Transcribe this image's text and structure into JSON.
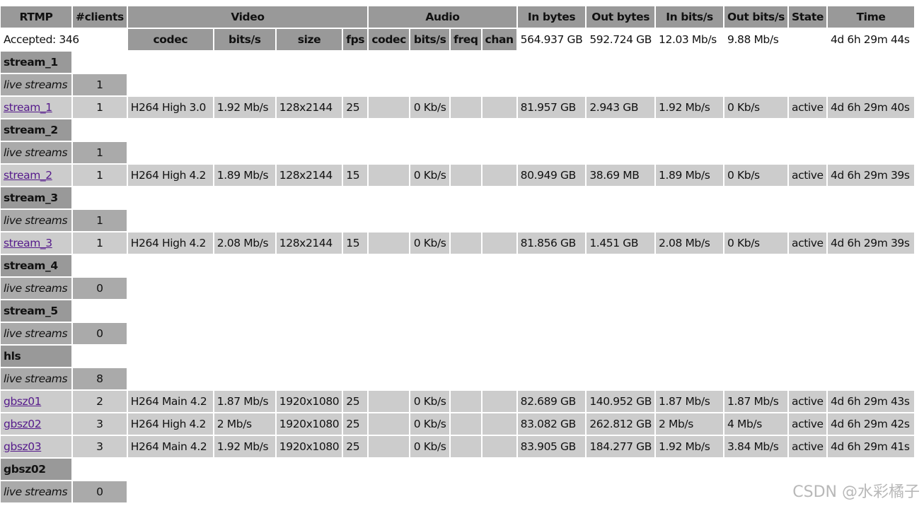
{
  "header": {
    "rtmp": "RTMP",
    "clients": "#clients",
    "video": "Video",
    "audio": "Audio",
    "in_bytes": "In bytes",
    "out_bytes": "Out bytes",
    "in_bits": "In bits/s",
    "out_bits": "Out bits/s",
    "state": "State",
    "time": "Time",
    "video_sub": [
      "codec",
      "bits/s",
      "size",
      "fps"
    ],
    "audio_sub": [
      "codec",
      "bits/s",
      "freq",
      "chan"
    ]
  },
  "summary": {
    "accepted": "Accepted: 346",
    "in_bytes": "564.937 GB",
    "out_bytes": "592.724 GB",
    "in_bits": "12.03 Mb/s",
    "out_bits": "9.88 Mb/s",
    "time": "4d 6h 29m 44s"
  },
  "live_label": "live streams",
  "applications": [
    {
      "name": "stream_1",
      "live_count": "1",
      "streams": [
        {
          "name": "stream_1",
          "clients": "1",
          "vcodec": "H264 High 3.0",
          "vbits": "1.92 Mb/s",
          "size": "128x2144",
          "fps": "25",
          "acodec": "",
          "abits": "0 Kb/s",
          "freq": "",
          "chan": "",
          "in_bytes": "81.957 GB",
          "out_bytes": "2.943 GB",
          "in_bits": "1.92 Mb/s",
          "out_bits": "0 Kb/s",
          "state": "active",
          "time": "4d 6h 29m 40s"
        }
      ]
    },
    {
      "name": "stream_2",
      "live_count": "1",
      "streams": [
        {
          "name": "stream_2",
          "clients": "1",
          "vcodec": "H264 High 4.2",
          "vbits": "1.89 Mb/s",
          "size": "128x2144",
          "fps": "15",
          "acodec": "",
          "abits": "0 Kb/s",
          "freq": "",
          "chan": "",
          "in_bytes": "80.949 GB",
          "out_bytes": "38.69 MB",
          "in_bits": "1.89 Mb/s",
          "out_bits": "0 Kb/s",
          "state": "active",
          "time": "4d 6h 29m 39s"
        }
      ]
    },
    {
      "name": "stream_3",
      "live_count": "1",
      "streams": [
        {
          "name": "stream_3",
          "clients": "1",
          "vcodec": "H264 High 4.2",
          "vbits": "2.08 Mb/s",
          "size": "128x2144",
          "fps": "15",
          "acodec": "",
          "abits": "0 Kb/s",
          "freq": "",
          "chan": "",
          "in_bytes": "81.856 GB",
          "out_bytes": "1.451 GB",
          "in_bits": "2.08 Mb/s",
          "out_bits": "0 Kb/s",
          "state": "active",
          "time": "4d 6h 29m 39s"
        }
      ]
    },
    {
      "name": "stream_4",
      "live_count": "0",
      "streams": []
    },
    {
      "name": "stream_5",
      "live_count": "0",
      "streams": []
    },
    {
      "name": "hls",
      "live_count": "8",
      "streams": [
        {
          "name": "gbsz01",
          "clients": "2",
          "vcodec": "H264 Main 4.2",
          "vbits": "1.87 Mb/s",
          "size": "1920x1080",
          "fps": "25",
          "acodec": "",
          "abits": "0 Kb/s",
          "freq": "",
          "chan": "",
          "in_bytes": "82.689 GB",
          "out_bytes": "140.952 GB",
          "in_bits": "1.87 Mb/s",
          "out_bits": "1.87 Mb/s",
          "state": "active",
          "time": "4d 6h 29m 43s"
        },
        {
          "name": "gbsz02",
          "clients": "3",
          "vcodec": "H264 High 4.2",
          "vbits": "2 Mb/s",
          "size": "1920x1080",
          "fps": "25",
          "acodec": "",
          "abits": "0 Kb/s",
          "freq": "",
          "chan": "",
          "in_bytes": "83.082 GB",
          "out_bytes": "262.812 GB",
          "in_bits": "2 Mb/s",
          "out_bits": "4 Mb/s",
          "state": "active",
          "time": "4d 6h 29m 42s"
        },
        {
          "name": "gbsz03",
          "clients": "3",
          "vcodec": "H264 Main 4.2",
          "vbits": "1.92 Mb/s",
          "size": "1920x1080",
          "fps": "25",
          "acodec": "",
          "abits": "0 Kb/s",
          "freq": "",
          "chan": "",
          "in_bytes": "83.905 GB",
          "out_bytes": "184.277 GB",
          "in_bits": "1.92 Mb/s",
          "out_bits": "3.84 Mb/s",
          "state": "active",
          "time": "4d 6h 29m 41s"
        }
      ]
    },
    {
      "name": "gbsz02",
      "live_count": "0",
      "streams": []
    }
  ],
  "watermark": "CSDN @水彩橘子"
}
